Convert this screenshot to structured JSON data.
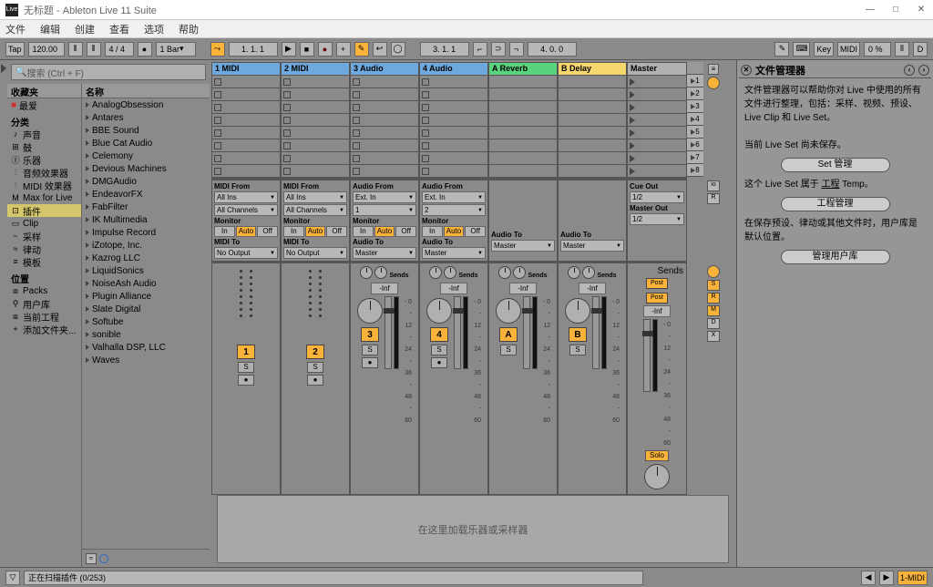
{
  "window": {
    "title": "无标题 - Ableton Live 11 Suite",
    "logo": "Live"
  },
  "menu": [
    "文件",
    "编辑",
    "创建",
    "查看",
    "选项",
    "帮助"
  ],
  "toolbar": {
    "tap": "Tap",
    "tempo": "120.00",
    "timesig": "4 / 4",
    "metronome": "●",
    "quantize": "1 Bar",
    "position": "1.  1.  1",
    "loop_start": "3.  1.  1",
    "loop_len": "4.  0.  0",
    "key": "Key",
    "midi": "MIDI",
    "pct": "0 %",
    "disk": "D"
  },
  "browser": {
    "search_placeholder": "搜索 (Ctrl + F)",
    "favorites_header": "收藏夹",
    "favorites": [
      "最爱"
    ],
    "name_header": "名称",
    "cat_header": "分类",
    "categories": [
      {
        "icon": "♪",
        "label": "声音"
      },
      {
        "icon": "⊞",
        "label": "鼓"
      },
      {
        "icon": "Ⓘ",
        "label": "乐器"
      },
      {
        "icon": "⫶",
        "label": "音频效果器"
      },
      {
        "icon": "⫶",
        "label": "MIDI 效果器"
      },
      {
        "icon": "M",
        "label": "Max for Live"
      },
      {
        "icon": "⊡",
        "label": "插件",
        "selected": true
      },
      {
        "icon": "▭",
        "label": "Clip"
      },
      {
        "icon": "~",
        "label": "采样"
      },
      {
        "icon": "≈",
        "label": "律动"
      },
      {
        "icon": "≡",
        "label": "模板"
      }
    ],
    "loc_header": "位置",
    "locations": [
      {
        "icon": "⧈",
        "label": "Packs"
      },
      {
        "icon": "⚲",
        "label": "用户库"
      },
      {
        "icon": "⧈",
        "label": "当前工程"
      },
      {
        "icon": "+",
        "label": "添加文件夹..."
      }
    ],
    "items": [
      "AnalogObsession",
      "Antares",
      "BBE Sound",
      "Blue Cat Audio",
      "Celemony",
      "Devious Machines",
      "DMGAudio",
      "EndeavorFX",
      "FabFilter",
      "IK Multimedia",
      "Impulse Record",
      "iZotope, Inc.",
      "Kazrog LLC",
      "LiquidSonics",
      "NoiseAsh Audio",
      "Plugin Alliance",
      "Slate Digital",
      "Softube",
      "sonible",
      "Valhalla DSP, LLC",
      "Waves"
    ]
  },
  "tracks": [
    {
      "name": "1 MIDI",
      "color": "c1",
      "num": "1",
      "kind": "midi"
    },
    {
      "name": "2 MIDI",
      "color": "c2",
      "num": "2",
      "kind": "midi"
    },
    {
      "name": "3 Audio",
      "color": "c3",
      "num": "3",
      "kind": "audio"
    },
    {
      "name": "4 Audio",
      "color": "c4",
      "num": "4",
      "kind": "audio"
    },
    {
      "name": "A Reverb",
      "color": "c5",
      "num": "A",
      "kind": "return"
    },
    {
      "name": "B Delay",
      "color": "c6",
      "num": "B",
      "kind": "return"
    }
  ],
  "master": {
    "name": "Master",
    "solo": "Solo"
  },
  "scenes": [
    "1",
    "2",
    "3",
    "4",
    "5",
    "6",
    "7",
    "8"
  ],
  "io": {
    "midi_from": "MIDI From",
    "all_ins": "All Ins",
    "all_ch": "All Channels",
    "monitor": "Monitor",
    "in": "In",
    "auto": "Auto",
    "off": "Off",
    "midi_to": "MIDI To",
    "no_output": "No Output",
    "audio_from": "Audio From",
    "ext_in": "Ext. In",
    "ch1": "1",
    "ch2": "2",
    "audio_to": "Audio To",
    "master": "Master",
    "cue_out": "Cue Out",
    "master_out": "Master Out",
    "out12": "1/2"
  },
  "mixer": {
    "sends": "Sends",
    "inf": "-Inf",
    "s": "S",
    "rec": "●",
    "post": "Post",
    "db0": "0",
    "dbs": [
      "0",
      "12",
      "24",
      "36",
      "48",
      "60"
    ]
  },
  "detail_placeholder": "在这里加载乐器或采样器",
  "status": {
    "text": "正在扫描插件 (0/253)",
    "midi_btn": "1-MIDI"
  },
  "filemgr": {
    "title": "文件管理器",
    "body1": "文件管理器可以帮助你对 Live 中使用的所有文件进行整理，包括：采样、视频、预设、Live Clip 和 Live Set。",
    "body2": "当前 Live Set 尚未保存。",
    "btn1": "Set 管理",
    "body3_a": "这个 Live Set 属于",
    "body3_b": "工程",
    "body3_c": " Temp。",
    "btn2": "工程管理",
    "body4": "在保存预设、律动或其他文件时，用户库是默认位置。",
    "btn3": "管理用户库"
  }
}
